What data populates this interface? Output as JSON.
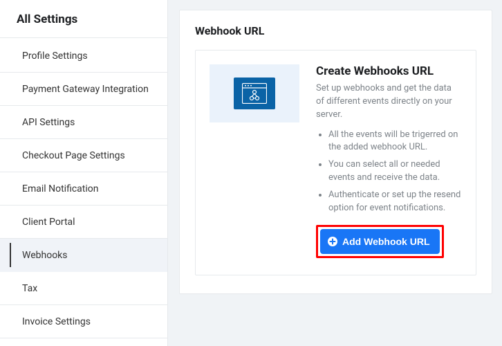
{
  "sidebar": {
    "title": "All Settings",
    "items": [
      {
        "label": "Profile Settings"
      },
      {
        "label": "Payment Gateway Integration"
      },
      {
        "label": "API Settings"
      },
      {
        "label": "Checkout Page Settings"
      },
      {
        "label": "Email Notification"
      },
      {
        "label": "Client Portal"
      },
      {
        "label": "Webhooks"
      },
      {
        "label": "Tax"
      },
      {
        "label": "Invoice Settings"
      }
    ],
    "activeIndex": 6
  },
  "main": {
    "panelTitle": "Webhook URL",
    "heading": "Create Webhooks URL",
    "description": "Set up webhooks and get the data of different events directly on your server.",
    "bullets": [
      "All the events will be trigerred on the added webhook URL.",
      "You can select all or needed events and receive the data.",
      "Authenticate or set up the resend option for event notifications."
    ],
    "addButton": "Add Webhook URL"
  },
  "icons": {
    "featureIcon": "webhook-browser-icon",
    "plusIcon": "plus-circle-icon"
  }
}
